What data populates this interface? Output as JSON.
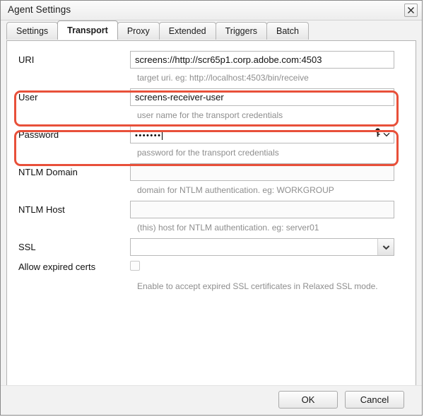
{
  "window": {
    "title": "Agent Settings",
    "close_icon": "close-icon"
  },
  "tabs": [
    {
      "label": "Settings",
      "active": false
    },
    {
      "label": "Transport",
      "active": true
    },
    {
      "label": "Proxy",
      "active": false
    },
    {
      "label": "Extended",
      "active": false
    },
    {
      "label": "Triggers",
      "active": false
    },
    {
      "label": "Batch",
      "active": false
    }
  ],
  "form": {
    "uri": {
      "label": "URI",
      "value": "screens://http://scr65p1.corp.adobe.com:4503",
      "hint": "target uri. eg: http://localhost:4503/bin/receive"
    },
    "user": {
      "label": "User",
      "value": "screens-receiver-user",
      "hint": "user name for the transport credentials"
    },
    "password": {
      "label": "Password",
      "value": "•••••••",
      "hint": "password for the transport credentials",
      "key_icon": "key-icon",
      "chevron_icon": "chevron-down-icon"
    },
    "ntlm_domain": {
      "label": "NTLM Domain",
      "value": "",
      "hint": "domain for NTLM authentication. eg: WORKGROUP"
    },
    "ntlm_host": {
      "label": "NTLM Host",
      "value": "",
      "hint": "(this) host for NTLM authentication. eg: server01"
    },
    "ssl": {
      "label": "SSL",
      "value": "",
      "arrow_icon": "chevron-down-icon"
    },
    "allow_expired_certs": {
      "label": "Allow expired certs",
      "checked": false,
      "hint": "Enable to accept expired SSL certificates in Relaxed SSL mode."
    }
  },
  "footer": {
    "ok_label": "OK",
    "cancel_label": "Cancel"
  },
  "colors": {
    "annotation": "#e8503a",
    "hint_text": "#8e8e8e"
  }
}
